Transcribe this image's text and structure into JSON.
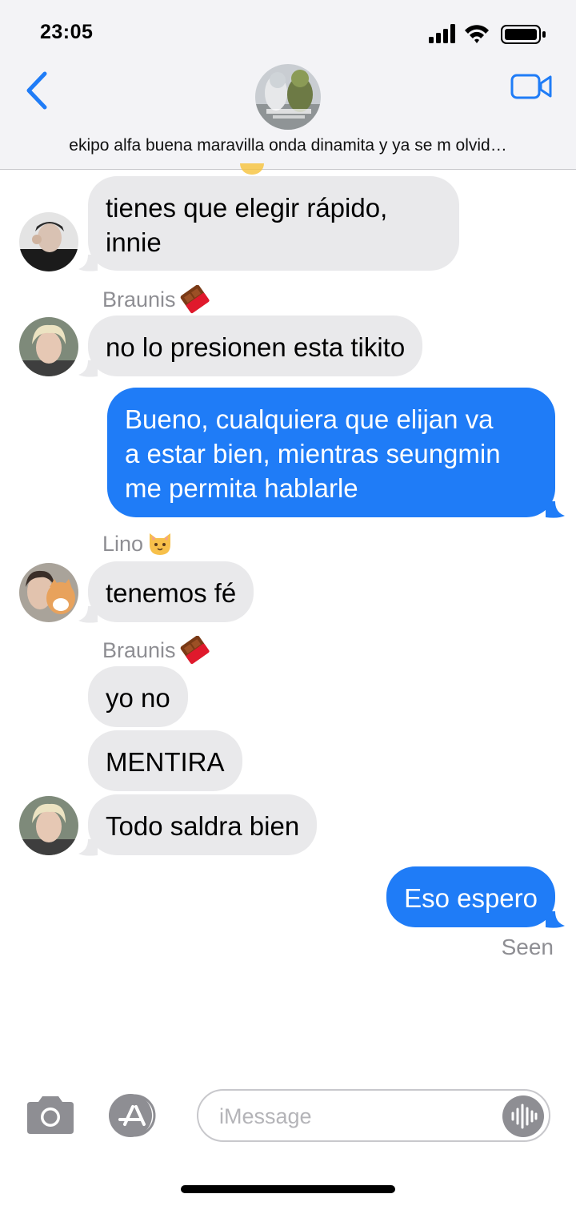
{
  "status_bar": {
    "time": "23:05"
  },
  "header": {
    "group_name": "ekipo alfa buena maravilla onda dinamita y ya se m olvid…",
    "colors": {
      "accent": "#1f7cf7",
      "background": "#f3f3f6"
    },
    "icons": {
      "back": "chevron-left-icon",
      "video": "video-camera-icon"
    }
  },
  "messages": [
    {
      "from": "other",
      "text_line1": "tienes que elegir rápido,",
      "text_line2": "innie"
    },
    {
      "from": "other",
      "sender": "Braunis",
      "sender_emoji": "chocolate-bar",
      "text": "no lo presionen esta tikito"
    },
    {
      "from": "me",
      "text_line1": "Bueno, cualquiera que elijan va",
      "text_line2": "a estar bien, mientras seungmin",
      "text_line3": "me permita hablarle"
    },
    {
      "from": "other",
      "sender": "Lino",
      "sender_emoji": "cat-face",
      "text": "tenemos fé"
    },
    {
      "from": "other",
      "sender": "Braunis",
      "sender_emoji": "chocolate-bar",
      "text": "yo no"
    },
    {
      "from": "other",
      "text": "MENTIRA"
    },
    {
      "from": "other",
      "text": "Todo saldra bien"
    },
    {
      "from": "me",
      "text": "Eso espero"
    }
  ],
  "read_receipt": "Seen",
  "compose": {
    "placeholder": "iMessage",
    "icons": {
      "camera": "camera-icon",
      "apps": "app-store-icon",
      "audio": "waveform-icon"
    }
  },
  "colors": {
    "incoming_bubble": "#e9e9eb",
    "outgoing_bubble": "#1f7cf7",
    "secondary_text": "#8e8e93"
  }
}
